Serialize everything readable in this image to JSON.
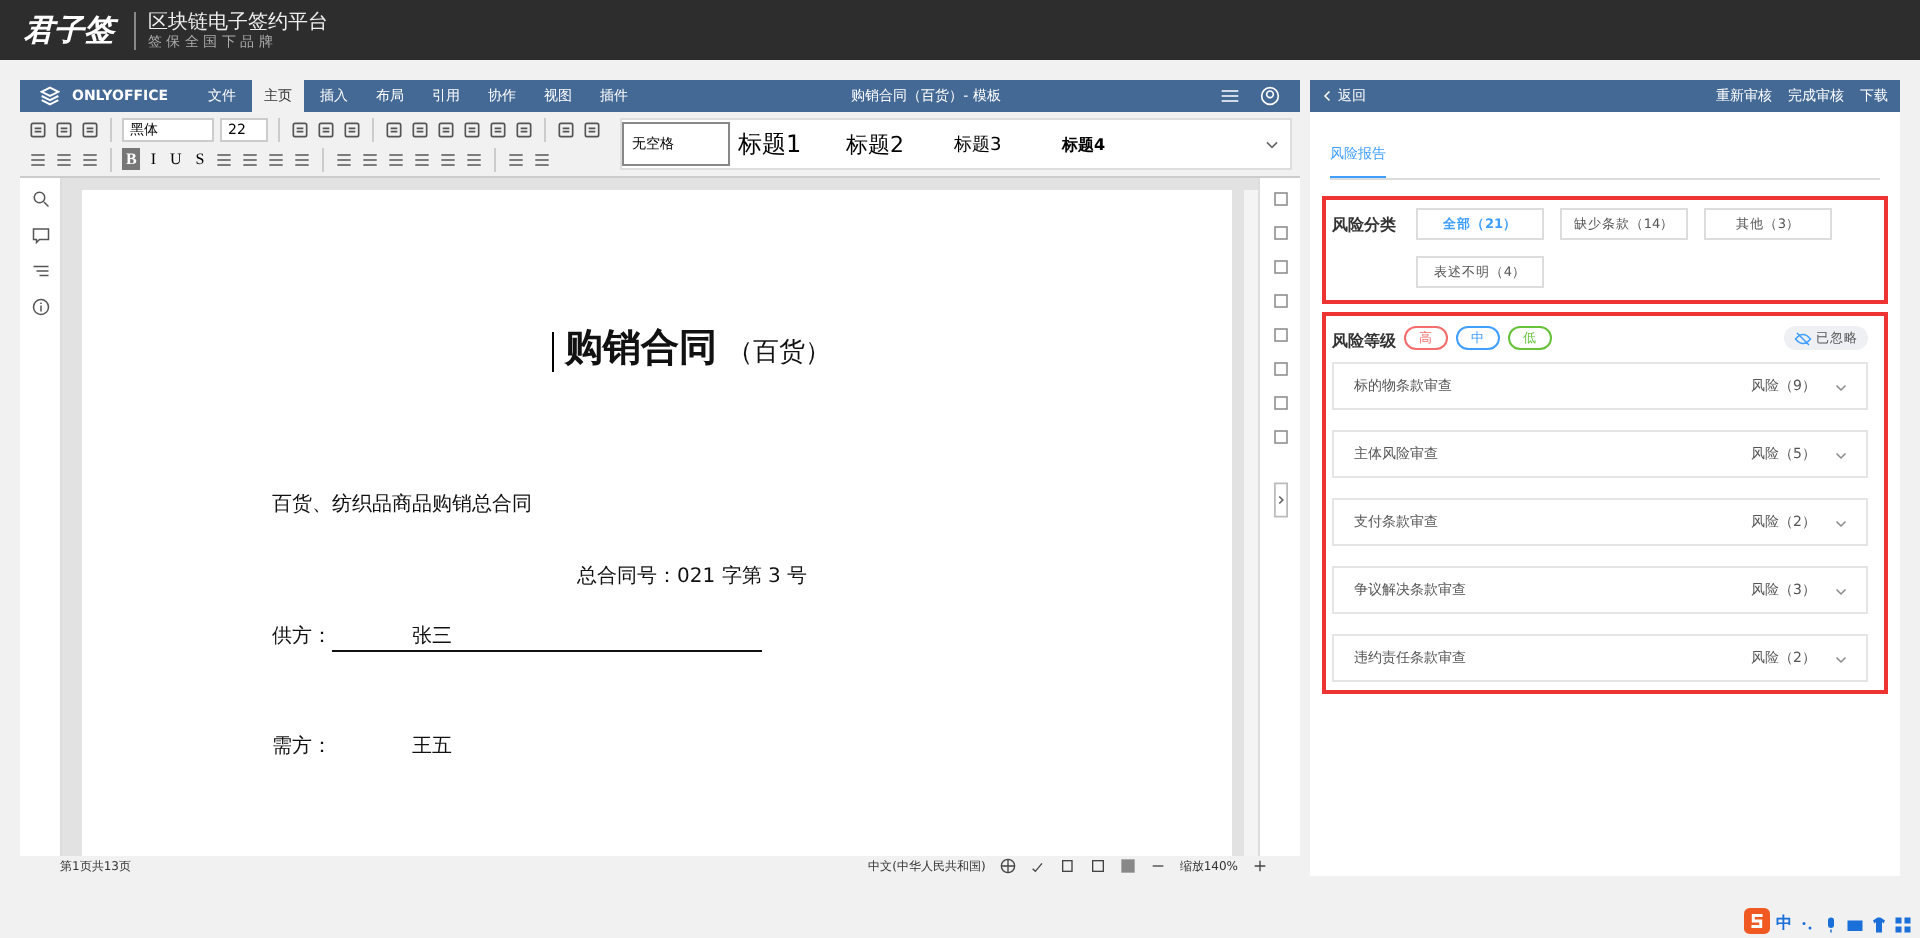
{
  "header": {
    "logo": "君子签",
    "slogan": "区块链电子签约平台",
    "subslogan": "签 保 全 国 下 品 牌"
  },
  "editor": {
    "brand": "ONLYOFFICE",
    "title": "购销合同（百货）- 模板",
    "tabs": [
      {
        "label": "文件",
        "selected": false
      },
      {
        "label": "主页",
        "selected": true
      },
      {
        "label": "插入",
        "selected": false
      },
      {
        "label": "布局",
        "selected": false
      },
      {
        "label": "引用",
        "selected": false
      },
      {
        "label": "协作",
        "selected": false
      },
      {
        "label": "视图",
        "selected": false
      },
      {
        "label": "插件",
        "selected": false
      }
    ],
    "font": "黑体",
    "font_size": "22",
    "format_buttons": [
      {
        "label": "B",
        "selected": true
      },
      {
        "label": "I",
        "selected": false
      },
      {
        "label": "U",
        "selected": false
      },
      {
        "label": "S",
        "selected": false
      }
    ],
    "styles": [
      {
        "label": "无空格",
        "selected": true
      },
      {
        "label": "标题1",
        "selected": false
      },
      {
        "label": "标题2",
        "selected": false
      },
      {
        "label": "标题3",
        "selected": false
      },
      {
        "label": "标题4",
        "selected": false
      }
    ],
    "document": {
      "title": "购销合同",
      "title_suffix": "（百货）",
      "subtitle": "百货、纺织品商品购销总合同",
      "contract_no": "总合同号：021  字第 3  号",
      "supplier_label": "供方：",
      "supplier": "张三",
      "buyer_label": "需方：",
      "buyer": "王五"
    },
    "status_bar": {
      "pages": "第1页共13页",
      "language": "中文(中华人民共和国)",
      "zoom": "缩放140%"
    }
  },
  "panel": {
    "back": "返回",
    "actions": [
      "重新审核",
      "完成审核",
      "下载"
    ],
    "tab": "风险报告",
    "category_label": "风险分类",
    "categories": [
      {
        "label": "全部（21）",
        "selected": true
      },
      {
        "label": "缺少条款（14）",
        "selected": false
      },
      {
        "label": "其他（3）",
        "selected": false
      },
      {
        "label": "表述不明（4）",
        "selected": false
      }
    ],
    "level_label": "风险等级",
    "levels": [
      {
        "label": "高",
        "color": "#f56c6c"
      },
      {
        "label": "中",
        "color": "#409eff"
      },
      {
        "label": "低",
        "color": "#67c23a"
      }
    ],
    "ignored": "已忽略",
    "groups": [
      {
        "name": "标的物条款审查",
        "count": "风险（9）",
        "expanded": false
      },
      {
        "name": "主体风险审查",
        "count": "风险（5）",
        "expanded": false
      },
      {
        "name": "支付条款审查",
        "count": "风险（2）",
        "expanded": false
      },
      {
        "name": "争议解决条款审查",
        "count": "风险（3）",
        "expanded": false
      },
      {
        "name": "违约责任条款审查",
        "count": "风险（2）",
        "expanded": false
      }
    ]
  },
  "tray": {
    "ime": "中"
  }
}
